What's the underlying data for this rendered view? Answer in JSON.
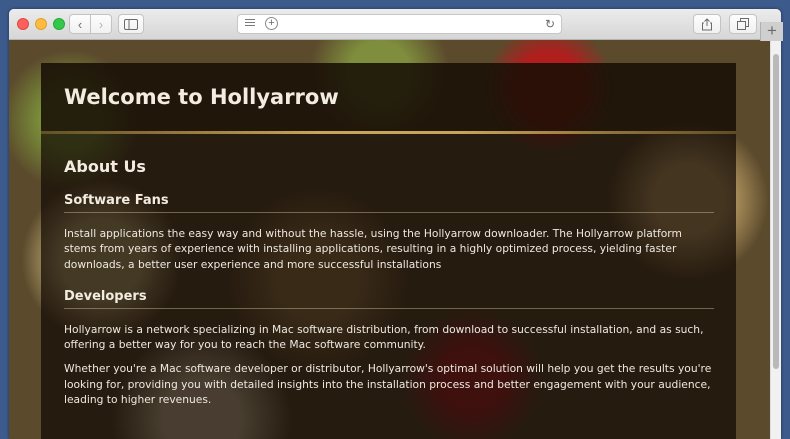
{
  "browser": {
    "buttons": {
      "back_icon": "chevron-left-icon",
      "forward_icon": "chevron-right-icon",
      "sidebar_icon": "sidebar-icon",
      "reader_icon": "reader-icon",
      "add_icon": "plus-circle-icon",
      "reload_icon": "reload-icon",
      "share_icon": "share-icon",
      "tabs_icon": "tabs-icon",
      "new_tab_icon": "plus-icon"
    }
  },
  "page": {
    "site_title": "Welcome to Hollyarrow",
    "about_heading": "About Us",
    "sections": [
      {
        "heading": "Software Fans",
        "paragraphs": [
          "Install applications the easy way and without the hassle, using the Hollyarrow downloader. The Hollyarrow platform stems from years of experience with installing applications, resulting in a highly optimized process, yielding faster downloads, a better user experience and more successful installations"
        ]
      },
      {
        "heading": "Developers",
        "paragraphs": [
          "Hollyarrow is a network specializing in Mac software distribution, from download to successful installation, and as such, offering a better way for you to reach the Mac software community.",
          "Whether you're a Mac software developer or distributor, Hollyarrow's optimal solution will help you get the results you're looking for, providing you with detailed insights into the installation process and better engagement with your audience, leading to higher revenues."
        ]
      }
    ]
  }
}
